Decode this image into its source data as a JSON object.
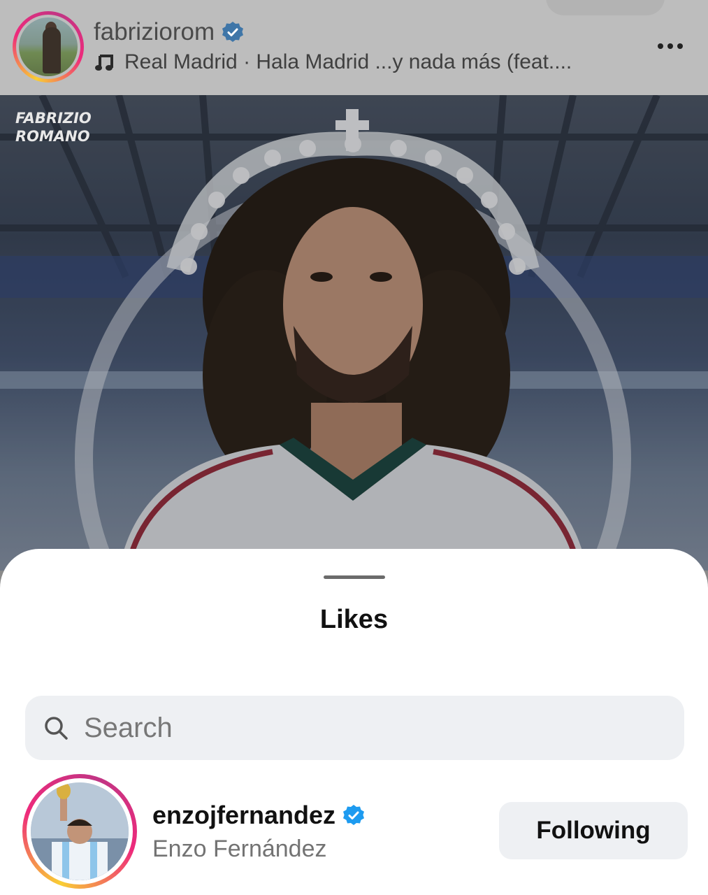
{
  "top_bar": {
    "clipped_title": "fabriziorom"
  },
  "post": {
    "username": "fabriziorom",
    "verified": true,
    "music_line": "Real Madrid · Hala Madrid ...y nada más (feat....",
    "more_icon": "more-horizontal-icon",
    "watermark_line1": "FABRIZIO",
    "watermark_line2": "ROMANO"
  },
  "likes_sheet": {
    "title": "Likes",
    "search": {
      "placeholder": "Search",
      "value": ""
    },
    "users": [
      {
        "username": "enzojfernandez",
        "full_name": "Enzo Fernández",
        "verified": true,
        "button_label": "Following"
      }
    ]
  },
  "colors": {
    "verified_blue": "#1d9bf0",
    "ring_gradient_start": "#f9ce34",
    "ring_gradient_mid": "#ee2a7b",
    "ring_gradient_end": "#c13584",
    "button_bg": "#eef0f3"
  }
}
